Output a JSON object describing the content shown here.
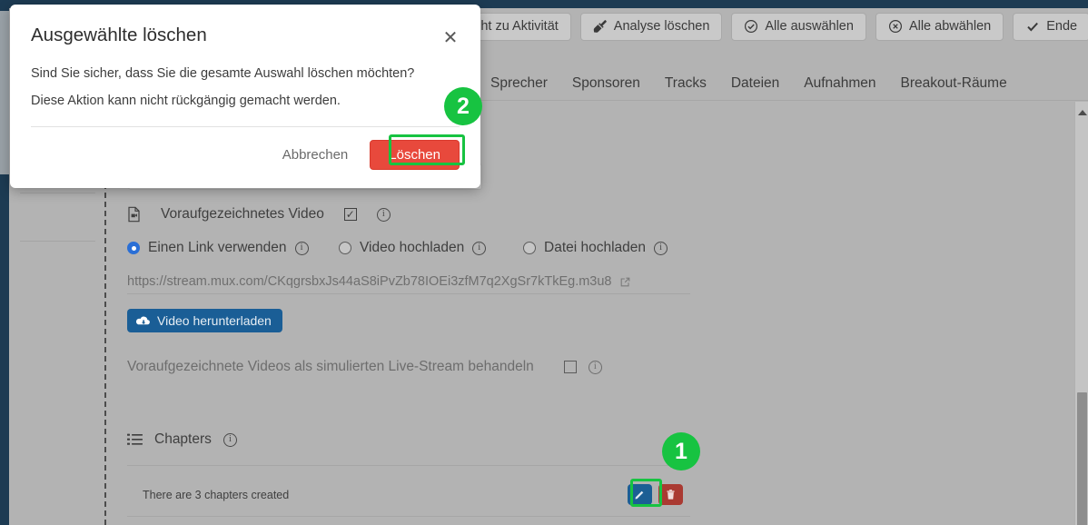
{
  "toolbar": {
    "buttons": [
      {
        "label": "ericht zu Aktivität",
        "icon": "none",
        "clipped": true
      },
      {
        "label": "Analyse löschen",
        "icon": "broom-icon",
        "clipped": false
      },
      {
        "label": "Alle auswählen",
        "icon": "check-circle-icon",
        "clipped": false
      },
      {
        "label": "Alle abwählen",
        "icon": "x-circle-icon",
        "clipped": false
      },
      {
        "label": "Ende",
        "icon": "check-icon",
        "clipped": false
      }
    ]
  },
  "nav": {
    "tabs": [
      {
        "label": "Sprecher"
      },
      {
        "label": "Sponsoren"
      },
      {
        "label": "Tracks"
      },
      {
        "label": "Dateien"
      },
      {
        "label": "Aufnahmen"
      },
      {
        "label": "Breakout-Räume"
      }
    ]
  },
  "content": {
    "prerecorded": {
      "label": "Voraufgezeichnetes Video",
      "checkbox_checked": true,
      "checkmark": "✓"
    },
    "source_options": [
      {
        "label": "Einen Link verwenden",
        "selected": true
      },
      {
        "label": "Video hochladen",
        "selected": false
      },
      {
        "label": "Datei hochladen",
        "selected": false
      }
    ],
    "url_value": "https://stream.mux.com/CKqgrsbxJs44aS8iPvZb78IOEi3zfM7q2XgSr7kTkEg.m3u8",
    "download_button_label": "Video herunterladen",
    "simulated_live": {
      "label": "Voraufgezeichnete Videos als simulierten Live-Stream behandeln",
      "checkbox_checked": false
    },
    "chapters": {
      "title": "Chapters",
      "row_text": "There are 3 chapters created",
      "edit_title": "Bearbeiten",
      "delete_title": "Löschen"
    }
  },
  "modal": {
    "title": "Ausgewählte löschen",
    "close_label": "✕",
    "line1": "Sind Sie sicher, dass Sie die gesamte Auswahl löschen möchten?",
    "line2": "Diese Aktion kann nicht rückgängig gemacht werden.",
    "cancel_label": "Abbrechen",
    "delete_label": "Löschen"
  },
  "annotations": {
    "badge1": "1",
    "badge2": "2"
  },
  "colors": {
    "accent_green": "#17c341",
    "danger_red": "#e8493c",
    "primary_blue": "#1a5e96",
    "radio_blue": "#2a6fd6",
    "page_bg": "#b3b3b3",
    "navy": "#1d3b53"
  },
  "info_glyph": "i"
}
